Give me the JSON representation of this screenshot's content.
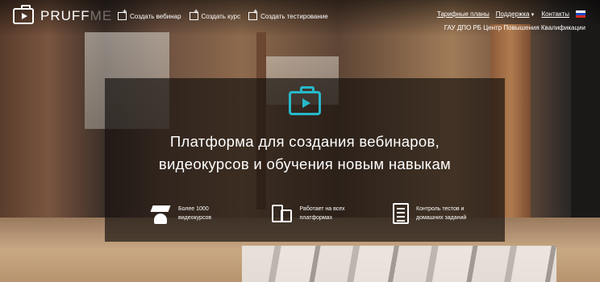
{
  "logo": {
    "brand_main": "PRUFF",
    "brand_faded": "ME"
  },
  "topnav": {
    "items": [
      {
        "label": "Создать вебинар"
      },
      {
        "label": "Создать курс"
      },
      {
        "label": "Создать тестирование"
      }
    ]
  },
  "rightnav": {
    "pricing": "Тарифные планы",
    "support": "Поддержка",
    "contacts": "Контакты"
  },
  "org_name": "ГАУ ДПО РБ Центр Повышения Квалификации",
  "hero": {
    "line1": "Платформа для создания вебинаров,",
    "line2": "видеокурсов и обучения новым навыкам"
  },
  "features": [
    {
      "text": "Более 1000 видеокурсов",
      "icon": "graduate-icon"
    },
    {
      "text": "Работает на всех платформах",
      "icon": "devices-icon"
    },
    {
      "text": "Контроль тестов и домашних заданий",
      "icon": "checklist-icon"
    }
  ],
  "colors": {
    "accent": "#27b8c9"
  }
}
